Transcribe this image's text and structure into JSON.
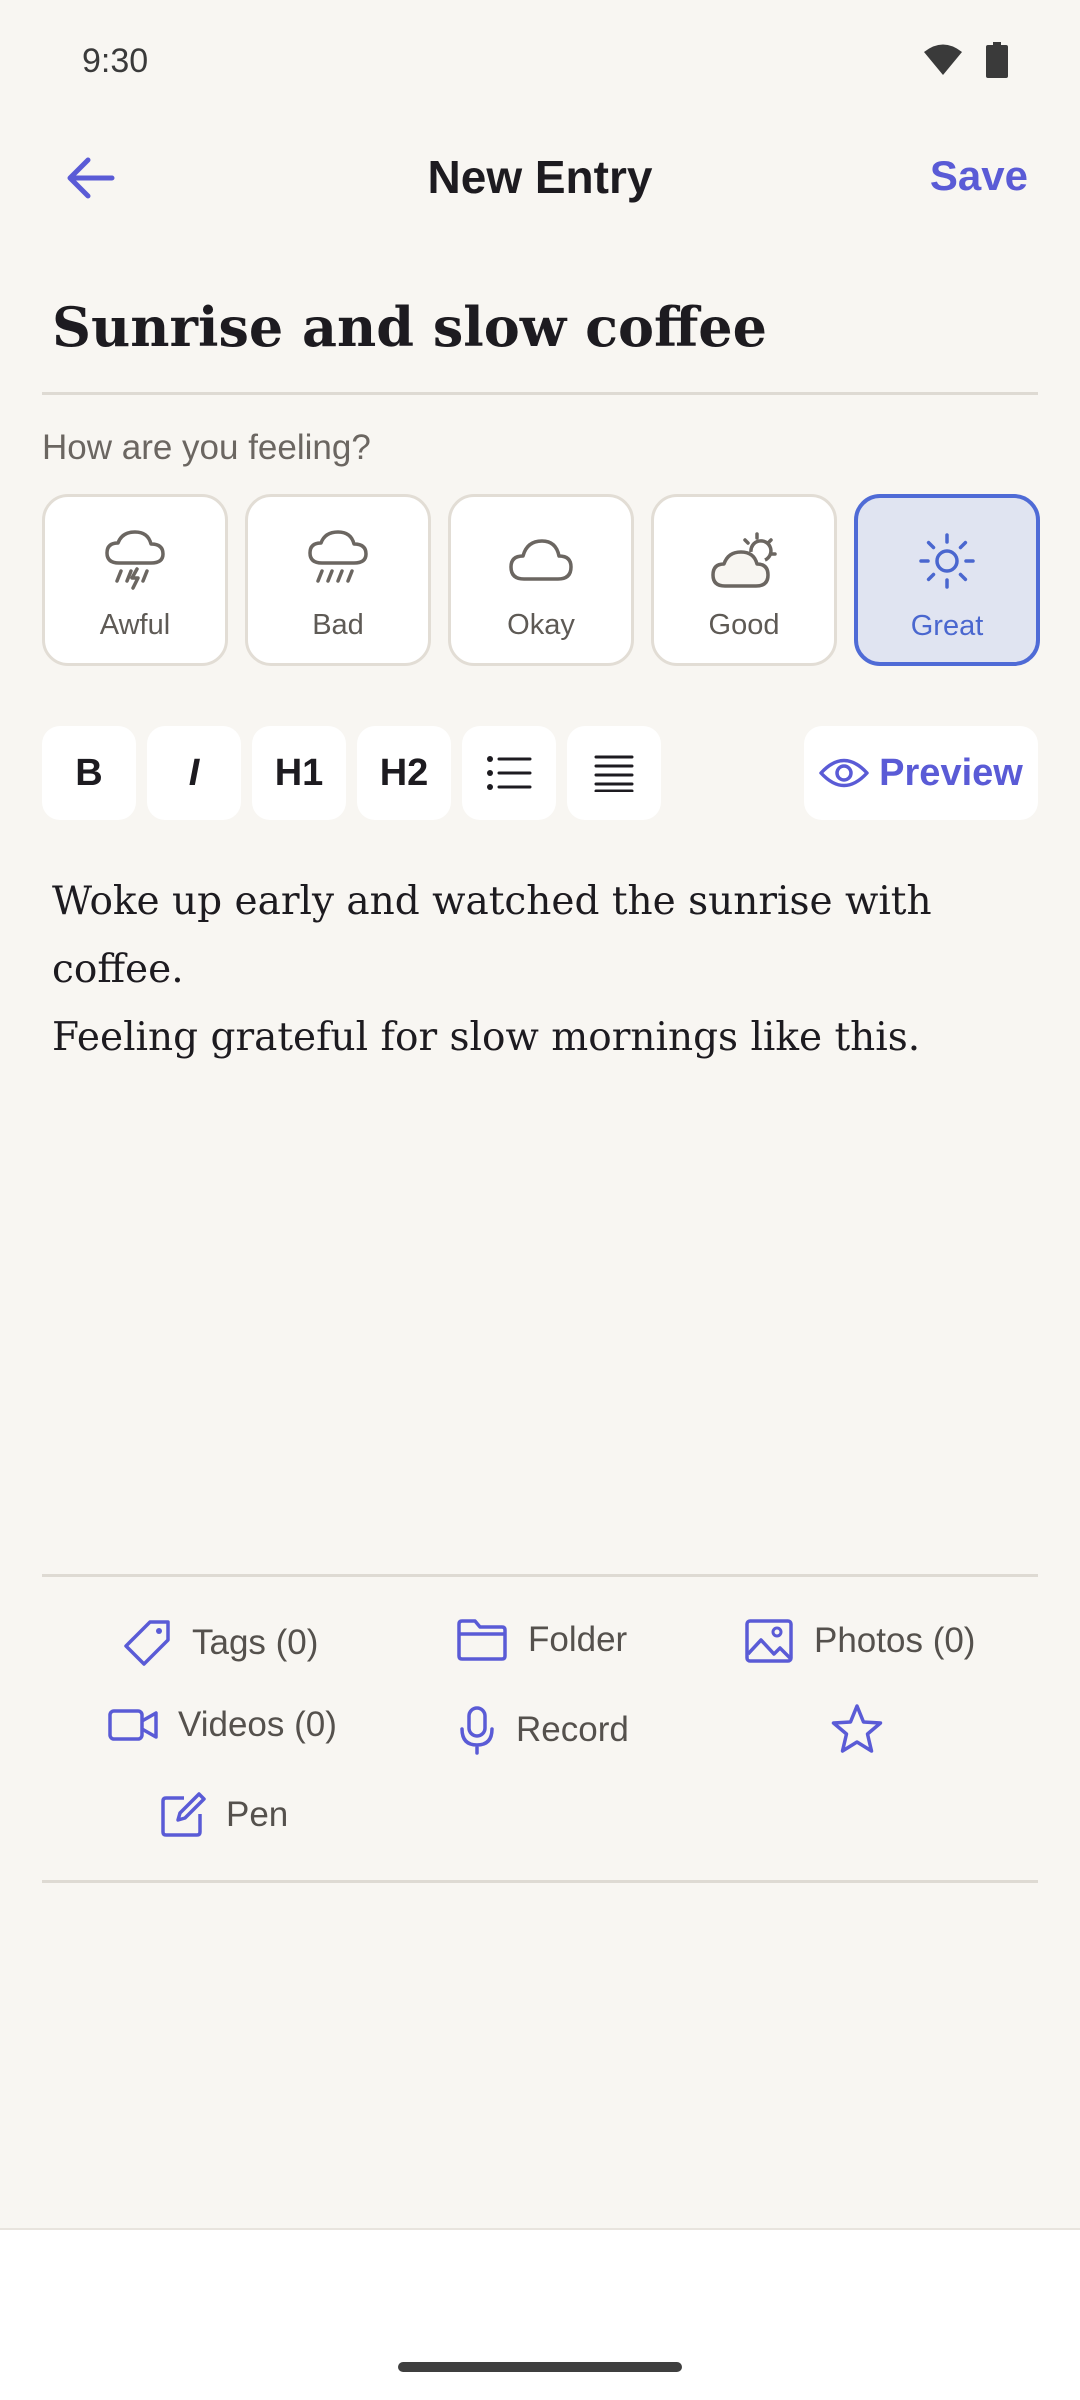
{
  "status_bar": {
    "time": "9:30"
  },
  "header": {
    "title": "New Entry",
    "save_label": "Save"
  },
  "entry": {
    "title": "Sunrise and slow coffee",
    "body_lines": [
      "Woke up early and watched the sunrise with coffee.",
      "Feeling grateful for slow mornings like this."
    ]
  },
  "mood": {
    "prompt": "How are you feeling?",
    "options": [
      {
        "label": "Awful",
        "icon": "thunderstorm-cloud-icon"
      },
      {
        "label": "Bad",
        "icon": "rain-cloud-icon"
      },
      {
        "label": "Okay",
        "icon": "cloud-icon"
      },
      {
        "label": "Good",
        "icon": "partly-sunny-icon"
      },
      {
        "label": "Great",
        "icon": "sun-icon"
      }
    ],
    "selected": "Great"
  },
  "toolbar": {
    "bold": "B",
    "italic": "I",
    "h1": "H1",
    "h2": "H2",
    "preview_label": "Preview"
  },
  "attachments": {
    "tags": "Tags (0)",
    "folder": "Folder",
    "photos": "Photos (0)",
    "videos": "Videos (0)",
    "record": "Record",
    "pen": "Pen"
  },
  "colors": {
    "accent": "#5a5bd6",
    "selected_mood_bg": "#e0e4f1",
    "selected_mood_border": "#4f6bd6",
    "background": "#f8f6f2"
  }
}
